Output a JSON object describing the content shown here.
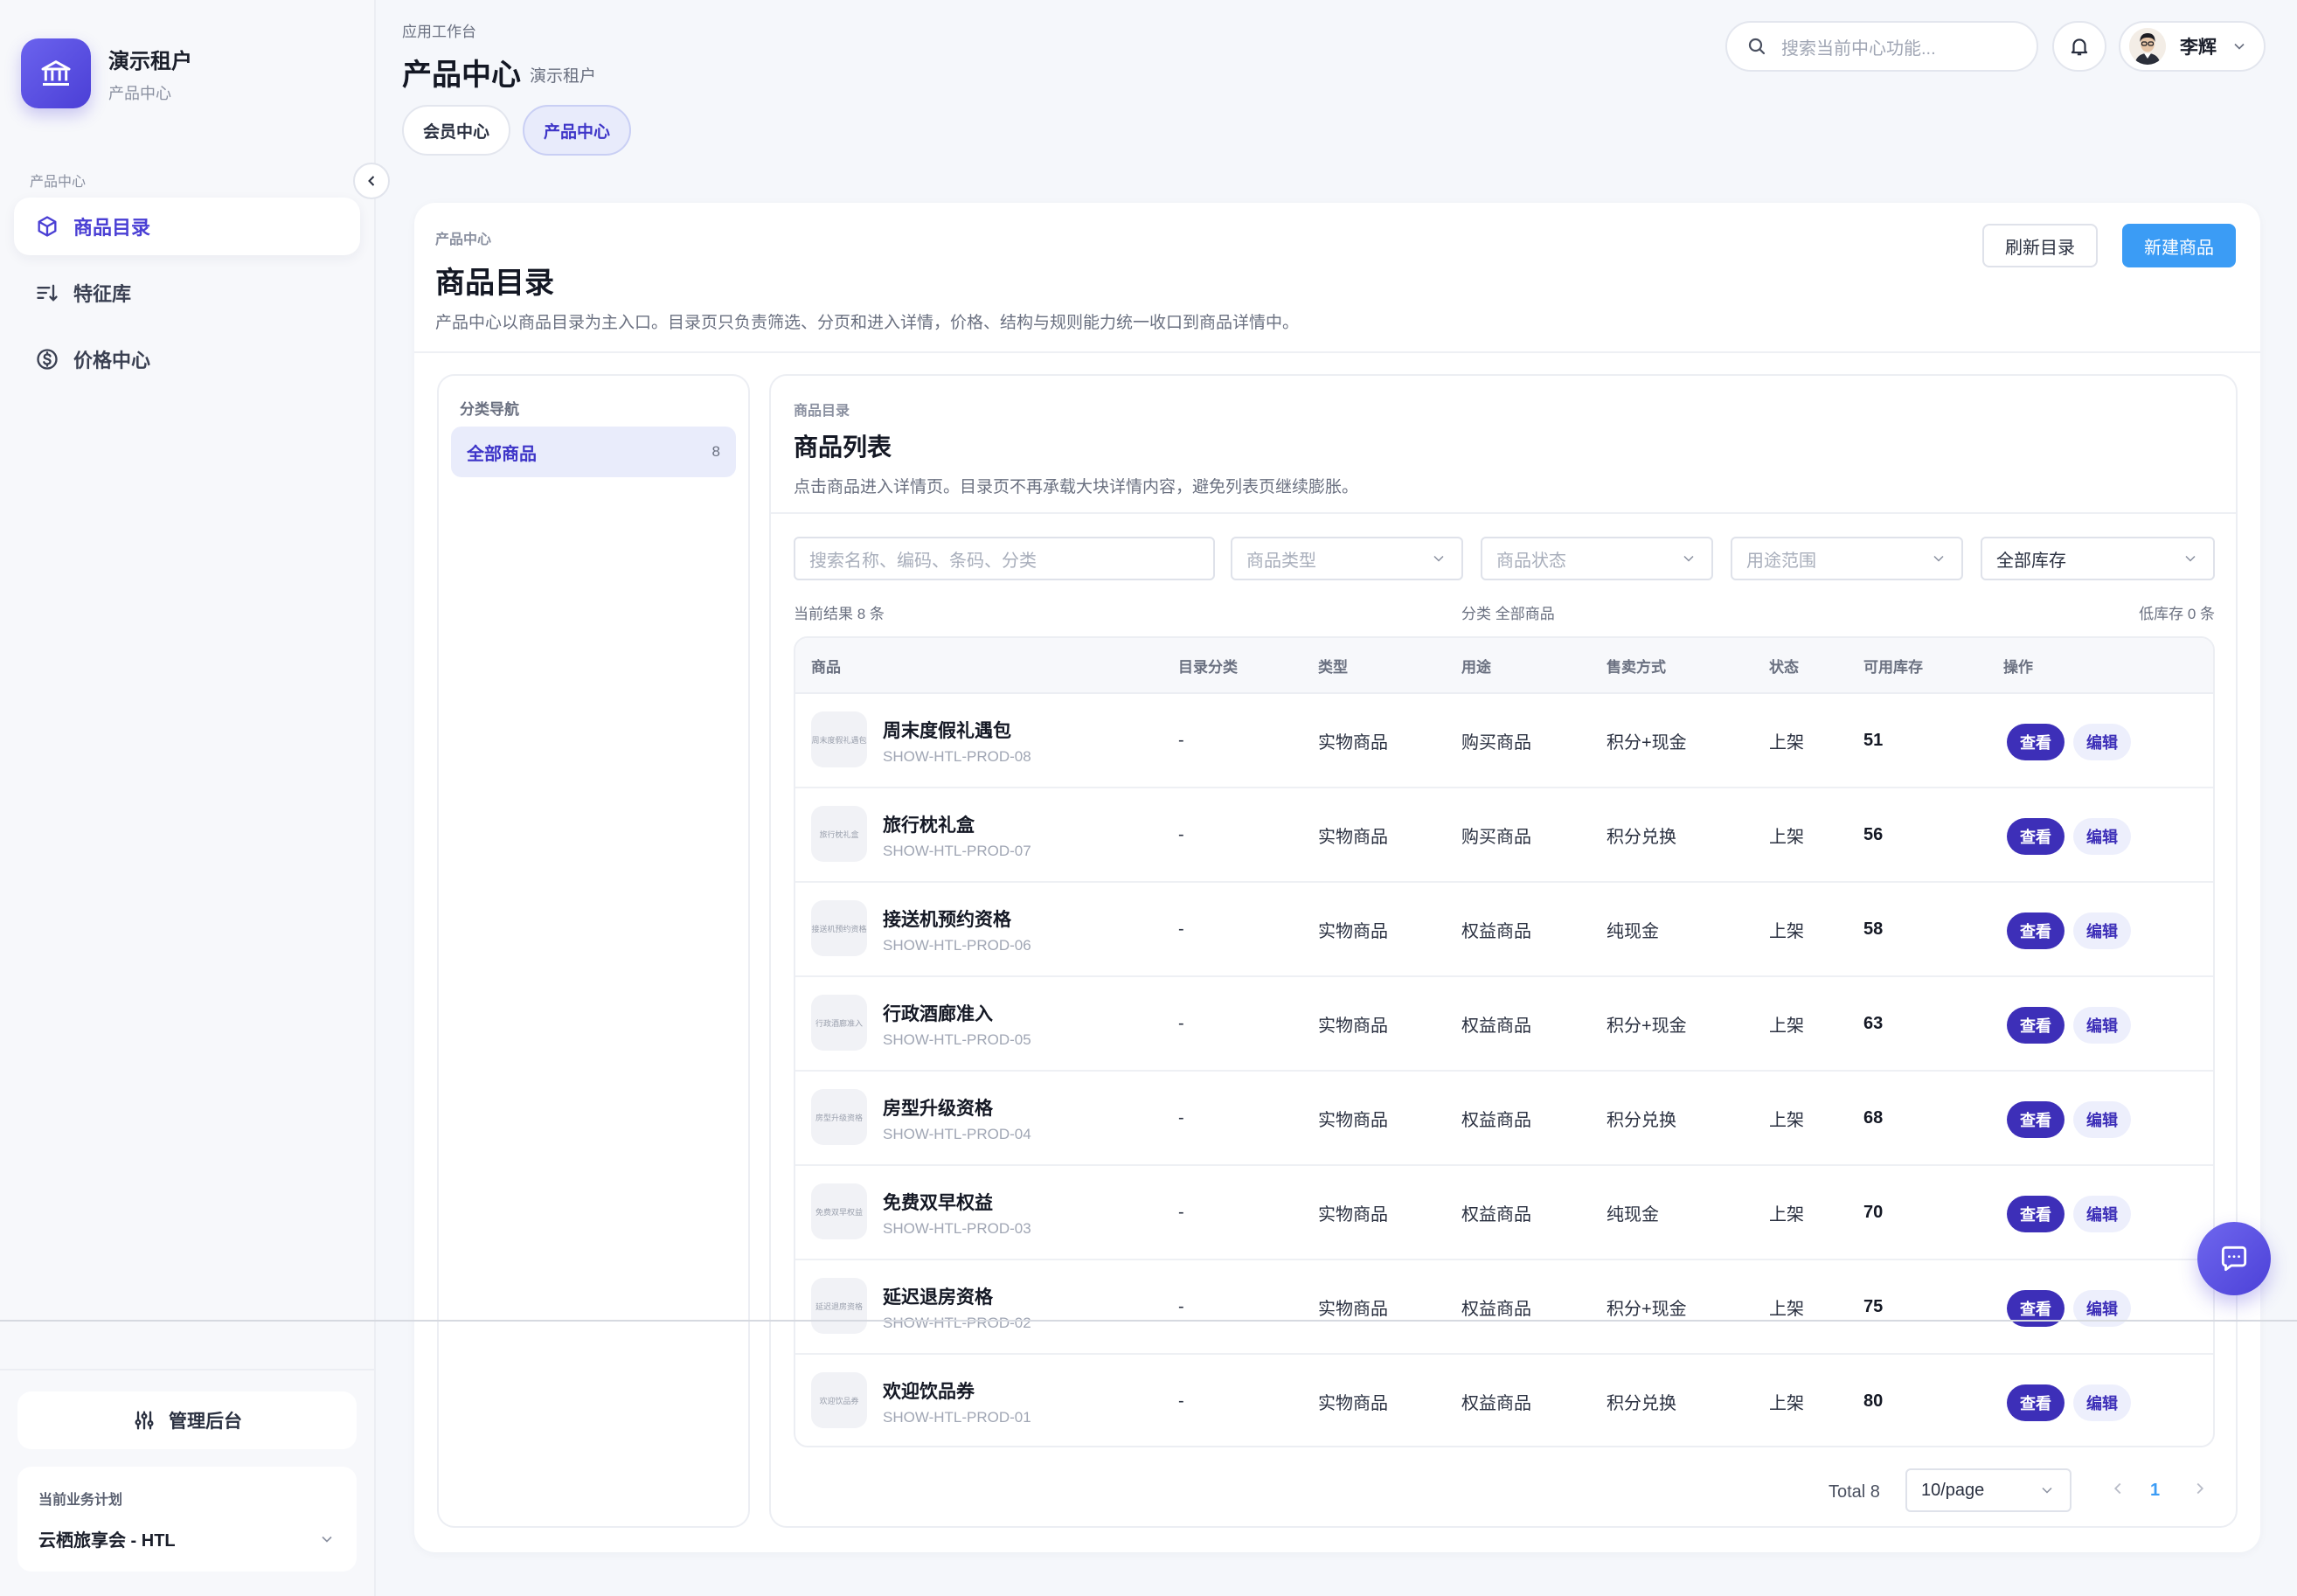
{
  "sidebar": {
    "brand_title": "演示租户",
    "brand_sub": "产品中心",
    "section_label": "产品中心",
    "items": [
      {
        "label": "商品目录",
        "icon": "cube-icon",
        "active": true
      },
      {
        "label": "特征库",
        "icon": "sort-lines-icon",
        "active": false
      },
      {
        "label": "价格中心",
        "icon": "dollar-circle-icon",
        "active": false
      }
    ],
    "admin_label": "管理后台",
    "plan_label": "当前业务计划",
    "plan_value": "云栖旅享会 - HTL"
  },
  "header": {
    "crumb": "应用工作台",
    "title": "产品中心",
    "subtitle": "演示租户",
    "tabs": [
      {
        "label": "会员中心",
        "active": false
      },
      {
        "label": "产品中心",
        "active": true
      }
    ],
    "search_placeholder": "搜索当前中心功能...",
    "user_name": "李辉"
  },
  "main": {
    "crumb": "产品中心",
    "title": "商品目录",
    "description": "产品中心以商品目录为主入口。目录页只负责筛选、分页和进入详情，价格、结构与规则能力统一收口到商品详情中。",
    "refresh_label": "刷新目录",
    "new_label": "新建商品"
  },
  "categories": {
    "label": "分类导航",
    "items": [
      {
        "label": "全部商品",
        "count": "8"
      }
    ]
  },
  "list": {
    "crumb": "商品目录",
    "title": "商品列表",
    "description": "点击商品进入详情页。目录页不再承载大块详情内容，避免列表页继续膨胀。",
    "filters": {
      "search_placeholder": "搜索名称、编码、条码、分类",
      "type_placeholder": "商品类型",
      "status_placeholder": "商品状态",
      "usage_placeholder": "用途范围",
      "stock_value": "全部库存"
    },
    "summary_left": "当前结果 8 条",
    "summary_mid": "分类 全部商品",
    "summary_right": "低库存 0 条",
    "columns": [
      "商品",
      "目录分类",
      "类型",
      "用途",
      "售卖方式",
      "状态",
      "可用库存",
      "操作"
    ],
    "rows": [
      {
        "name": "周末度假礼遇包",
        "code": "SHOW-HTL-PROD-08",
        "category": "-",
        "type": "实物商品",
        "usage": "购买商品",
        "sale": "积分+现金",
        "status": "上架",
        "stock": "51"
      },
      {
        "name": "旅行枕礼盒",
        "code": "SHOW-HTL-PROD-07",
        "category": "-",
        "type": "实物商品",
        "usage": "购买商品",
        "sale": "积分兑换",
        "status": "上架",
        "stock": "56"
      },
      {
        "name": "接送机预约资格",
        "code": "SHOW-HTL-PROD-06",
        "category": "-",
        "type": "实物商品",
        "usage": "权益商品",
        "sale": "纯现金",
        "status": "上架",
        "stock": "58"
      },
      {
        "name": "行政酒廊准入",
        "code": "SHOW-HTL-PROD-05",
        "category": "-",
        "type": "实物商品",
        "usage": "权益商品",
        "sale": "积分+现金",
        "status": "上架",
        "stock": "63"
      },
      {
        "name": "房型升级资格",
        "code": "SHOW-HTL-PROD-04",
        "category": "-",
        "type": "实物商品",
        "usage": "权益商品",
        "sale": "积分兑换",
        "status": "上架",
        "stock": "68"
      },
      {
        "name": "免费双早权益",
        "code": "SHOW-HTL-PROD-03",
        "category": "-",
        "type": "实物商品",
        "usage": "权益商品",
        "sale": "纯现金",
        "status": "上架",
        "stock": "70"
      },
      {
        "name": "延迟退房资格",
        "code": "SHOW-HTL-PROD-02",
        "category": "-",
        "type": "实物商品",
        "usage": "权益商品",
        "sale": "积分+现金",
        "status": "上架",
        "stock": "75"
      },
      {
        "name": "欢迎饮品券",
        "code": "SHOW-HTL-PROD-01",
        "category": "-",
        "type": "实物商品",
        "usage": "权益商品",
        "sale": "积分兑换",
        "status": "上架",
        "stock": "80"
      }
    ],
    "view_label": "查看",
    "edit_label": "编辑",
    "total_label": "Total 8",
    "page_size": "10/page",
    "current_page": "1"
  },
  "colors": {
    "accent": "#4a3fd4",
    "primary_button": "#3b9cf5",
    "view_button": "#3d2fb8"
  }
}
